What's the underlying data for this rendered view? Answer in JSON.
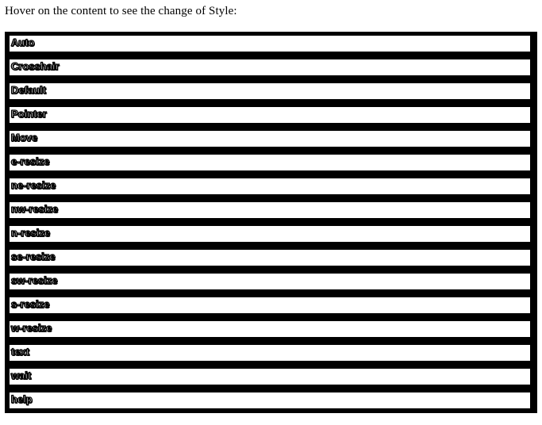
{
  "page": {
    "intro_text": "Hover on the content to see the change of Style:"
  },
  "styles": {
    "items": [
      {
        "label": "Auto"
      },
      {
        "label": "Crosshair"
      },
      {
        "label": "Default"
      },
      {
        "label": "Pointer"
      },
      {
        "label": "Move"
      },
      {
        "label": "e-resize"
      },
      {
        "label": "ne-resize"
      },
      {
        "label": "nw-resize"
      },
      {
        "label": "n-resize"
      },
      {
        "label": "se-resize"
      },
      {
        "label": "sw-resize"
      },
      {
        "label": "s-resize"
      },
      {
        "label": "w-resize"
      },
      {
        "label": "text"
      },
      {
        "label": "wait"
      },
      {
        "label": "help"
      }
    ]
  }
}
